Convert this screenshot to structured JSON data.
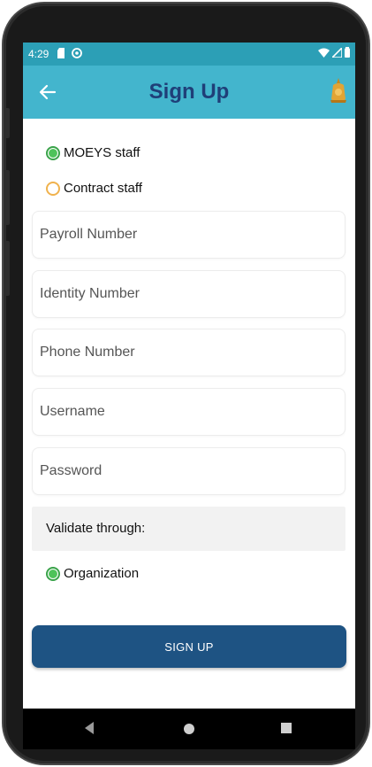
{
  "status_bar": {
    "time": "4:29",
    "left_icons": [
      "sd-card-icon",
      "sync-icon"
    ],
    "right_icons": [
      "wifi-icon",
      "signal-icon",
      "battery-icon"
    ]
  },
  "app_bar": {
    "title": "Sign Up",
    "back_icon": "arrow-left-icon",
    "logo_icon": "emblem-icon"
  },
  "staff_type": {
    "options": [
      {
        "label": "MOEYS staff",
        "checked": true
      },
      {
        "label": "Contract staff",
        "checked": false
      }
    ]
  },
  "form": {
    "fields": [
      {
        "placeholder": "Payroll Number",
        "value": ""
      },
      {
        "placeholder": "Identity Number",
        "value": ""
      },
      {
        "placeholder": "Phone Number",
        "value": ""
      },
      {
        "placeholder": "Username",
        "value": ""
      },
      {
        "placeholder": "Password",
        "value": ""
      }
    ]
  },
  "validate": {
    "label": "Validate through:",
    "option": {
      "label": "Organization",
      "checked": true
    }
  },
  "submit_label": "SIGN UP",
  "colors": {
    "status_bar": "#2c9fb6",
    "app_bar": "#43b5cd",
    "title": "#1f3f78",
    "button": "#1e5383",
    "radio_checked": "#4ec35a",
    "radio_unchecked": "#f0b24d"
  }
}
